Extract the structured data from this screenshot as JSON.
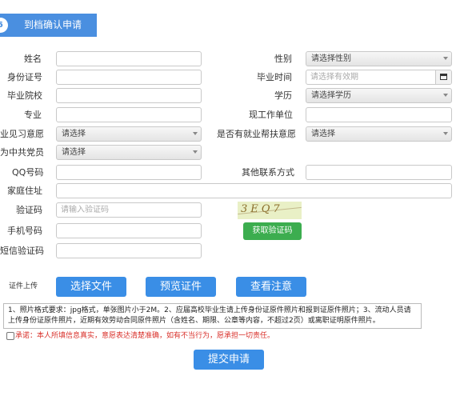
{
  "header": {
    "step": "5",
    "title": "到档确认申请"
  },
  "fields": {
    "name_label": "姓名",
    "gender_label": "性别",
    "gender_value": "请选择性别",
    "id_label": "身份证号",
    "grad_time_label": "毕业时间",
    "grad_time_placeholder": "请选择有效期",
    "school_label": "毕业院校",
    "degree_label": "学历",
    "degree_value": "请选择学历",
    "major_label": "专业",
    "workplace_label": "现工作单位",
    "internship_label": "业见习意愿",
    "internship_value": "请选择",
    "employment_help_label": "是否有就业帮扶意愿",
    "employment_help_value": "请选择",
    "party_label": "为中共党员",
    "party_value": "请选择",
    "qq_label": "QQ号码",
    "other_contact_label": "其他联系方式",
    "address_label": "家庭住址",
    "captcha_label": "验证码",
    "captcha_placeholder": "请输入验证码",
    "captcha_image_text": "3EQ7",
    "phone_label": "手机号码",
    "sms_label": "短信验证码",
    "get_code_button": "获取验证码"
  },
  "upload": {
    "label": "证件上传",
    "choose_file": "选择文件",
    "preview": "预览证件",
    "view_notes": "查看注意"
  },
  "notice": "1、照片格式要求：jpg格式，单张图片小于2M。2、应届高校毕业生请上传身份证原件照片和报到证原件照片；3、流动人员请上传身份证原件照片，近期有效劳动合同原件照片（含姓名、期限、公章等内容，不超过2页）或离职证明原件照片。",
  "promise": "承诺：本人所填信息真实，意愿表达清楚准确，如有不当行为，愿承担一切责任。",
  "submit_label": "提交申请",
  "colors": {
    "primary": "#3a8ee6",
    "green": "#3cad4f",
    "warning": "#d9312b"
  }
}
